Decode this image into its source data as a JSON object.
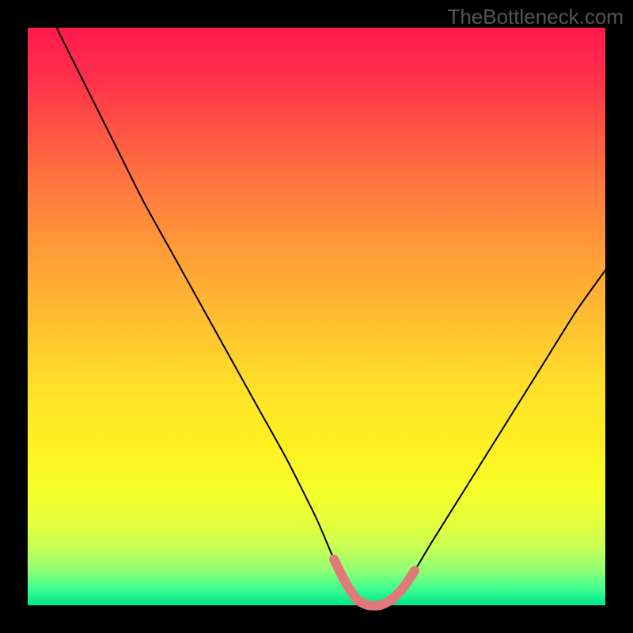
{
  "watermark": "TheBottleneck.com",
  "chart_data": {
    "type": "line",
    "title": "",
    "xlabel": "",
    "ylabel": "",
    "xlim": [
      0,
      100
    ],
    "ylim": [
      0,
      100
    ],
    "x": [
      5,
      10,
      15,
      20,
      25,
      30,
      35,
      40,
      45,
      50,
      53,
      55,
      57,
      59,
      61,
      63,
      65,
      67,
      70,
      75,
      80,
      85,
      90,
      95,
      100
    ],
    "values": [
      100,
      90,
      80,
      70,
      61,
      52,
      43,
      34,
      25,
      15,
      8,
      4,
      1,
      0,
      0,
      1,
      3,
      6,
      11,
      19,
      27,
      35,
      43,
      51,
      58
    ],
    "overlay": {
      "name": "bottleneck-band",
      "color": "#e07a7a",
      "x_range": [
        53,
        67
      ],
      "y": 0
    },
    "gradient_background": {
      "top_color": "#ff1a4d",
      "bottom_color": "#00e68a",
      "description": "red-to-green vertical gradient"
    }
  }
}
